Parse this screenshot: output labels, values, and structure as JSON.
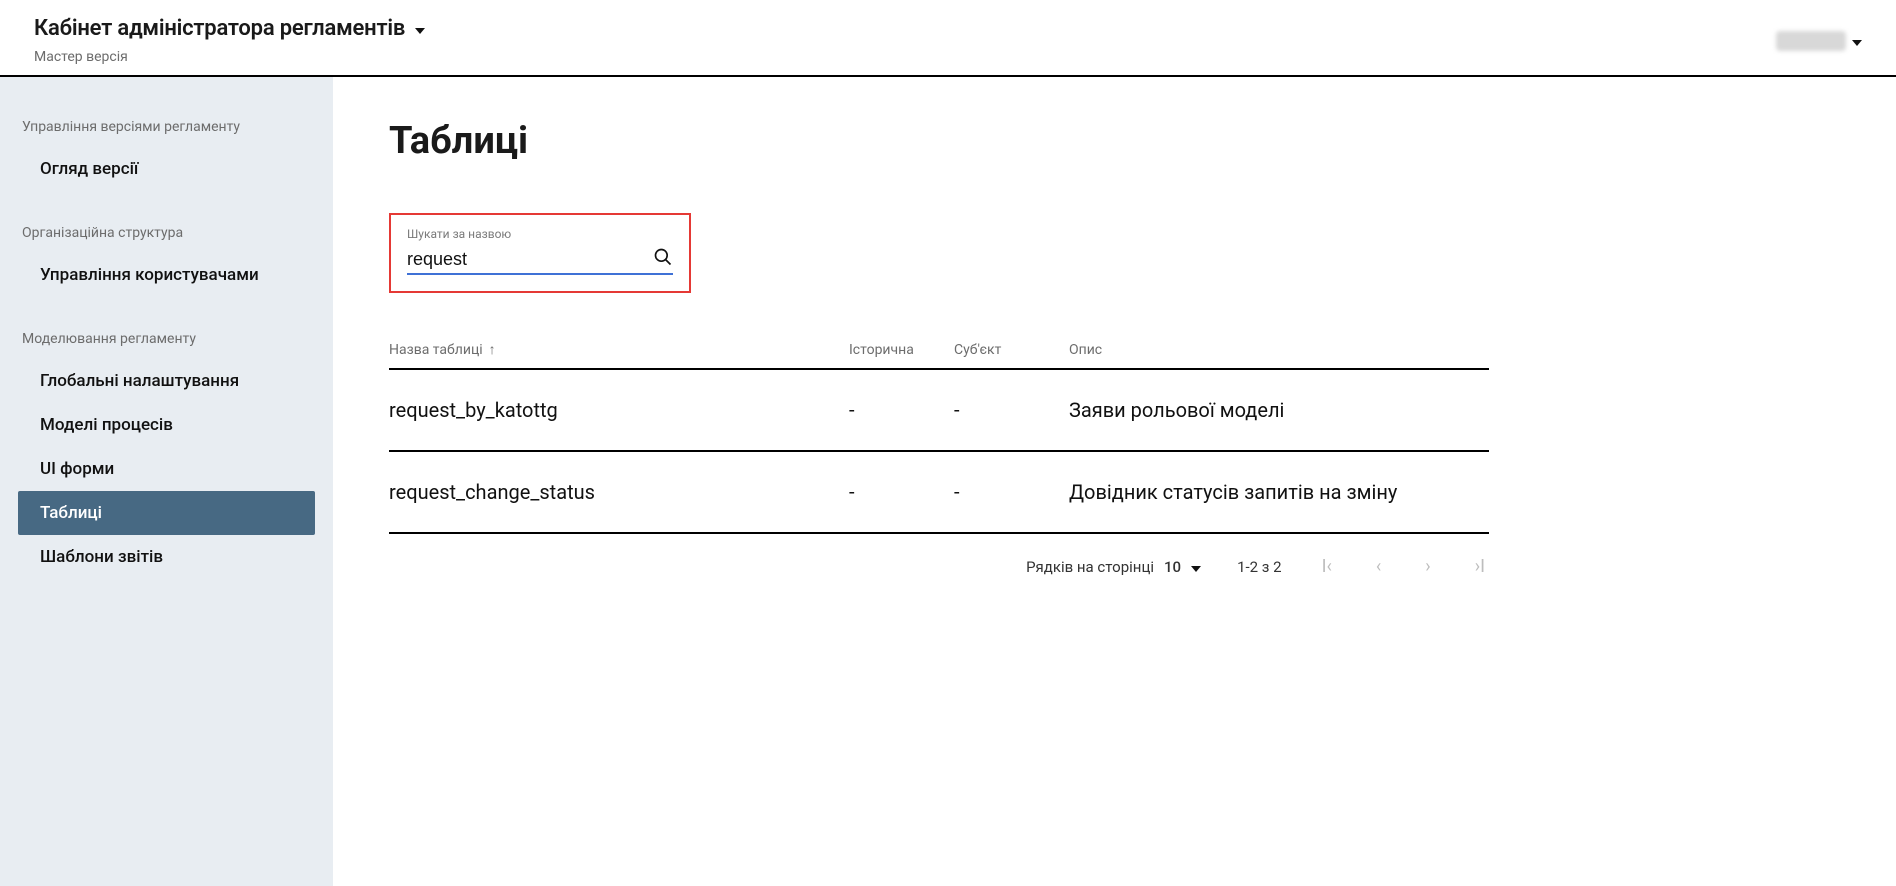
{
  "header": {
    "app_title": "Кабінет адміністратора регламентів",
    "subtitle": "Мастер версія"
  },
  "sidebar": {
    "groups": [
      {
        "title": "Управління версіями регламенту",
        "items": [
          {
            "key": "version-overview",
            "label": "Огляд версії",
            "active": false
          }
        ]
      },
      {
        "title": "Організаційна структура",
        "items": [
          {
            "key": "users-mgmt",
            "label": "Управління користувачами",
            "active": false
          }
        ]
      },
      {
        "title": "Моделювання регламенту",
        "items": [
          {
            "key": "global-settings",
            "label": "Глобальні налаштування",
            "active": false
          },
          {
            "key": "process-models",
            "label": "Моделі процесів",
            "active": false
          },
          {
            "key": "ui-forms",
            "label": "UI форми",
            "active": false
          },
          {
            "key": "tables",
            "label": "Таблиці",
            "active": true
          },
          {
            "key": "report-templates",
            "label": "Шаблони звітів",
            "active": false
          }
        ]
      }
    ]
  },
  "main": {
    "page_title": "Таблиці",
    "search": {
      "label": "Шукати за назвою",
      "value": "request"
    },
    "table": {
      "columns": [
        {
          "key": "name",
          "label": "Назва таблиці",
          "sort": "asc"
        },
        {
          "key": "historical",
          "label": "Історична"
        },
        {
          "key": "subject",
          "label": "Суб'єкт"
        },
        {
          "key": "desc",
          "label": "Опис"
        }
      ],
      "rows": [
        {
          "name": "request_by_katottg",
          "historical": "-",
          "subject": "-",
          "desc": "Заяви рольової моделі"
        },
        {
          "name": "request_change_status",
          "historical": "-",
          "subject": "-",
          "desc": "Довідник статусів запитів на зміну"
        }
      ]
    },
    "pagination": {
      "rows_per_label": "Рядків на сторінці",
      "rows_per_value": "10",
      "range_text": "1-2 з 2"
    }
  }
}
